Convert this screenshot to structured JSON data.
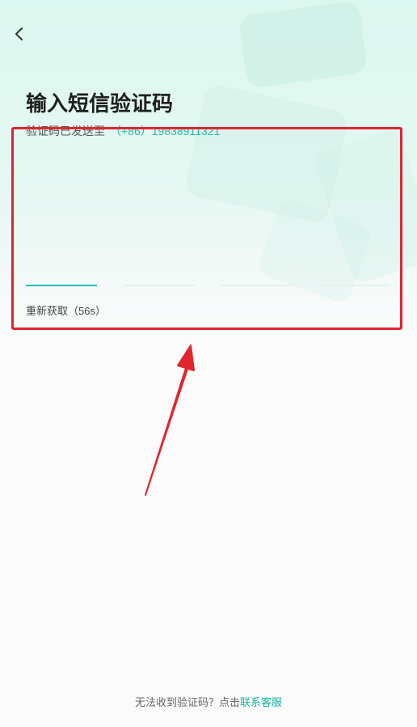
{
  "header": {
    "back_icon": "chevron-left-icon",
    "title": "输入短信验证码"
  },
  "verify": {
    "sent_prefix": "验证码已发送至",
    "phone": "（+86）19838911321",
    "code_slots": 4,
    "active_slot": 0,
    "resend_label": "重新获取（56s）"
  },
  "footer": {
    "question": "无法收到验证码？点击",
    "link": "联系客服"
  },
  "colors": {
    "accent": "#22c2ad",
    "link": "#14b39f",
    "annotation": "#e0262d"
  }
}
